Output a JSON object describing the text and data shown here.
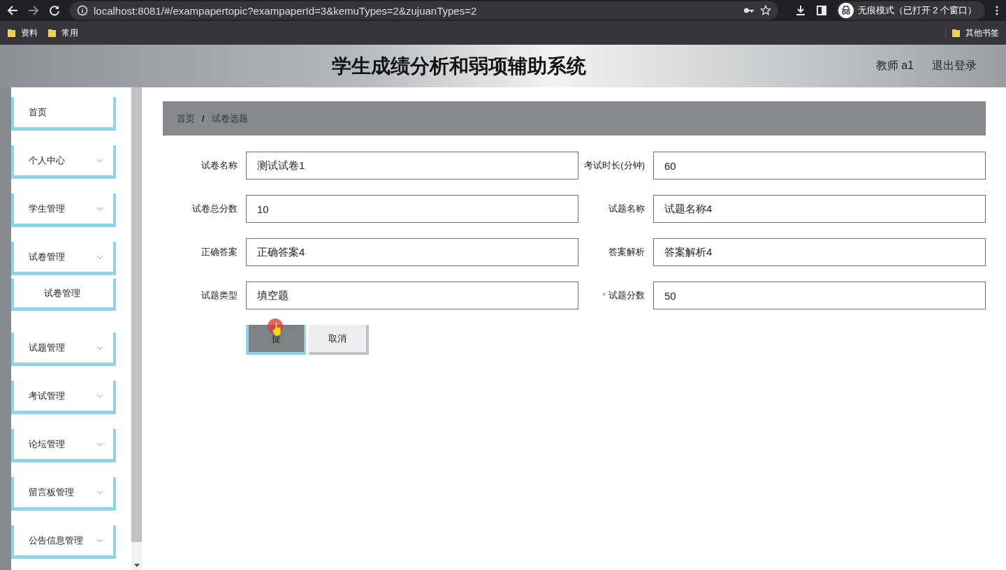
{
  "browser": {
    "url": "localhost:8081/#/exampapertopic?exampaperId=3&kemuTypes=2&zujuanTypes=2",
    "profile": "无痕模式（已打开 2 个窗口）",
    "bookmarks": [
      "资料",
      "常用"
    ],
    "other_bookmarks": "其他书签"
  },
  "header": {
    "title": "学生成绩分析和弱项辅助系统",
    "user": "教师 a1",
    "logout": "退出登录"
  },
  "sidebar": {
    "items": [
      {
        "label": "首页",
        "kind": "link"
      },
      {
        "label": "个人中心",
        "kind": "menu"
      },
      {
        "label": "学生管理",
        "kind": "menu"
      },
      {
        "label": "试卷管理",
        "kind": "menu",
        "children": [
          {
            "label": "试卷管理"
          }
        ]
      },
      {
        "label": "试题管理",
        "kind": "menu"
      },
      {
        "label": "考试管理",
        "kind": "menu"
      },
      {
        "label": "论坛管理",
        "kind": "menu"
      },
      {
        "label": "留言板管理",
        "kind": "menu"
      },
      {
        "label": "公告信息管理",
        "kind": "menu"
      }
    ]
  },
  "breadcrumb": {
    "items": [
      "首页",
      "试卷选题"
    ],
    "separator": "/"
  },
  "form": {
    "fields": [
      {
        "label": "试卷名称",
        "value": "测试试卷1"
      },
      {
        "label": "考试时长(分钟)",
        "value": "60"
      },
      {
        "label": "试卷总分数",
        "value": "10"
      },
      {
        "label": "试题名称",
        "value": "试题名称4"
      },
      {
        "label": "正确答案",
        "value": "正确答案4"
      },
      {
        "label": "答案解析",
        "value": "答案解析4"
      },
      {
        "label": "试题类型",
        "value": "填空题"
      },
      {
        "label": "试题分数",
        "value": "50",
        "required_mark": "*"
      }
    ],
    "buttons": [
      {
        "label": "提",
        "kind": "primary"
      },
      {
        "label": "取消",
        "kind": "default"
      }
    ]
  }
}
